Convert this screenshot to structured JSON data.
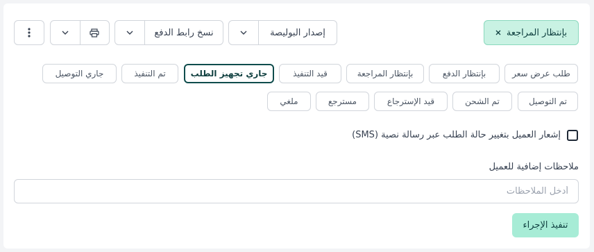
{
  "toolbar": {
    "status_pill": "بإنتظار المراجعة",
    "issue_policy_label": "إصدار البوليصة",
    "copy_payment_link_label": "نسخ رابط الدفع"
  },
  "statuses": [
    "طلب عرض سعر",
    "بإنتظار الدفع",
    "بإنتظار المراجعة",
    "قيد التنفيذ",
    "جاري تجهيز الطلب",
    "تم التنفيذ",
    "جاري التوصيل",
    "تم التوصيل",
    "تم الشحن",
    "قيد الإسترجاع",
    "مسترجع",
    "ملغي"
  ],
  "active_status": "جاري تجهيز الطلب",
  "notify": {
    "label": "إشعار العميل بتغيير حالة الطلب عبر رسالة نصية (SMS)",
    "checked": false
  },
  "notes": {
    "label": "ملاحظات إضافية للعميل",
    "placeholder": "أدخل الملاحظات",
    "value": ""
  },
  "submit_label": "تنفيذ الإجراء",
  "colors": {
    "accent": "#a7ecd6",
    "accent_border": "#8ad8bd",
    "active_border": "#0f4c4c"
  },
  "icons": [
    "close-icon",
    "chevron-down-icon",
    "printer-icon",
    "more-vertical-icon"
  ]
}
